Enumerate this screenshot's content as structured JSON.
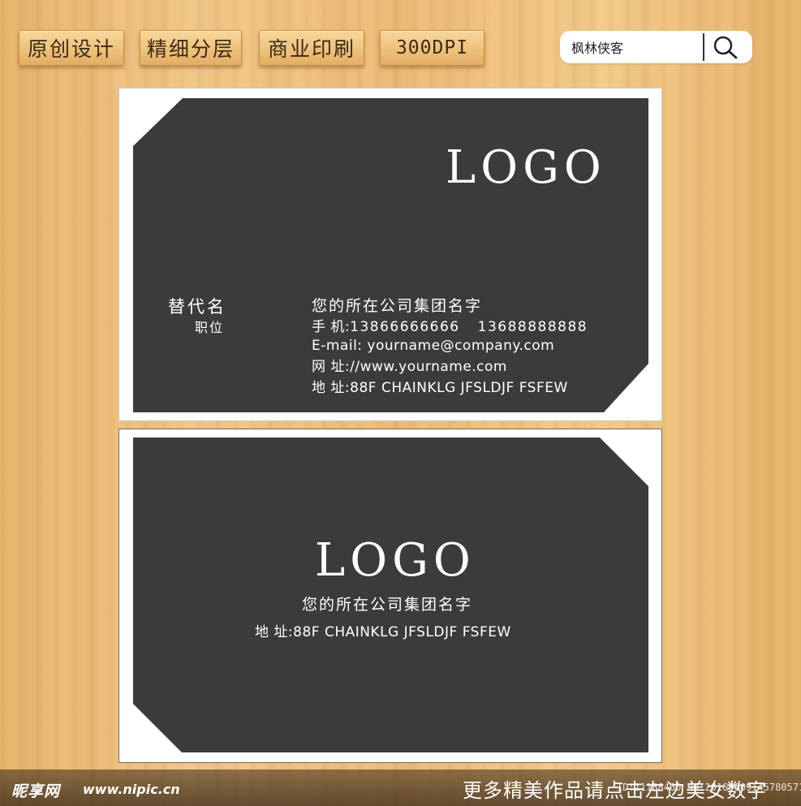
{
  "tags": [
    "原创设计",
    "精细分层",
    "商业印刷",
    "300DPI"
  ],
  "search": {
    "value": "枫林侠客"
  },
  "front": {
    "logo": "LOGO",
    "name": "替代名",
    "title": "职位",
    "company": "您的所在公司集团名字",
    "phone_label": "手 机:",
    "phone1": "13866666666",
    "phone2": "13688888888",
    "email": "E-mail: yourname@company.com",
    "web": "网 址://www.yourname.com",
    "address": "地 址:88F CHAINKLG JFSLDJF FSFEW"
  },
  "back": {
    "logo": "LOGO",
    "company": "您的所在公司集团名字",
    "address": "地 址:88F CHAINKLG JFSLDJF FSFEW"
  },
  "footer": {
    "site_logo": "昵享网",
    "site_url": "www.nipic.cn",
    "cta": "更多精美作品请点击左边美女数字",
    "code": "ID:11188460 NO:20160609145780571"
  },
  "colors": {
    "card": "#3d3a3a",
    "wood": "#f0c27f"
  },
  "icons": {
    "search": "magnifier-icon"
  }
}
